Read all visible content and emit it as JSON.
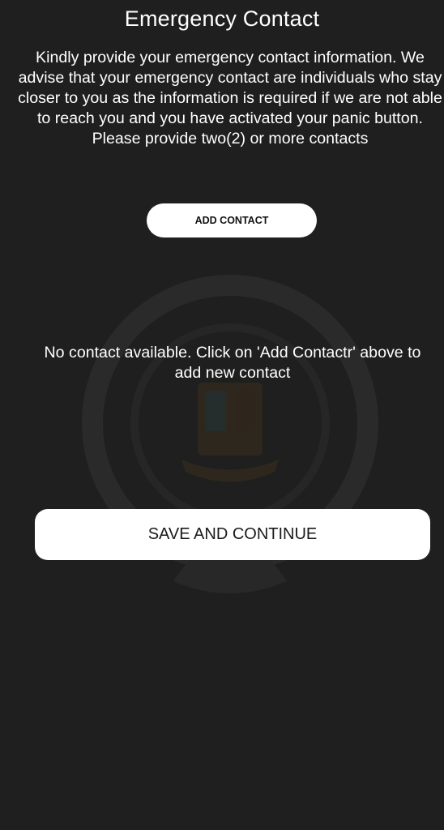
{
  "header": {
    "title": "Emergency Contact"
  },
  "intro": {
    "text": "Kindly provide your emergency contact information. We advise that your emergency contact are individuals who stay closer to you as the information is required if we are not able to reach you and you have activated your panic button. Please provide two(2) or more contacts"
  },
  "actions": {
    "add_contact_label": "ADD CONTACT",
    "save_label": "SAVE AND CONTINUE"
  },
  "contacts": {
    "empty_message": "No contact available. Click on 'Add Contactr' above to add new contact",
    "items": []
  },
  "watermark": {
    "icon": "emblem-ring-icon",
    "ring_color": "#2a2a2a",
    "emblem_color": "#4a3a22"
  },
  "colors": {
    "background": "#1f1f1f",
    "text": "#ffffff",
    "button_bg": "#ffffff",
    "button_text": "#111111"
  }
}
